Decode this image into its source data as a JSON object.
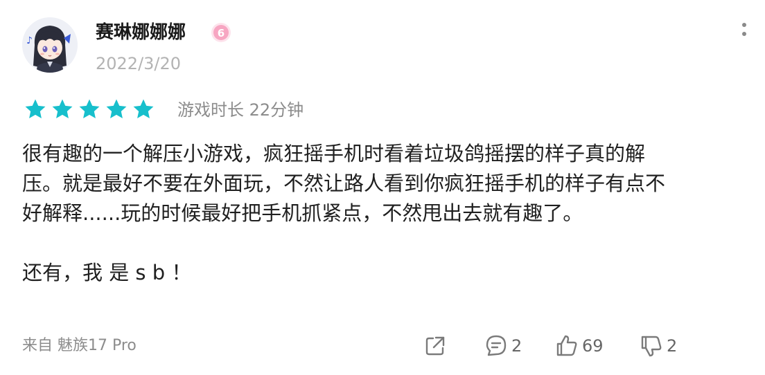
{
  "header": {
    "username": "赛琳娜娜娜",
    "date": "2022/3/20",
    "badge_icon": "level-badge-icon"
  },
  "rating": {
    "stars": 5,
    "max_stars": 5,
    "star_color": "#17bfcc",
    "playtime": "游戏时长 22分钟"
  },
  "review": {
    "lines": [
      "很有趣的一个解压小游戏，疯狂摇手机时看着垃圾鸽摇摆的样子真的解",
      "压。就是最好不要在外面玩，不然让路人看到你疯狂摇手机的样子有点不",
      "好解释......玩的时候最好把手机抓紧点，不然甩出去就有趣了。",
      "",
      "还有，我 是 s b ！"
    ]
  },
  "footer": {
    "device": "来自 魅族17 Pro",
    "share_icon": "share-icon",
    "comment_count": "2",
    "like_count": "69",
    "dislike_count": "2"
  }
}
